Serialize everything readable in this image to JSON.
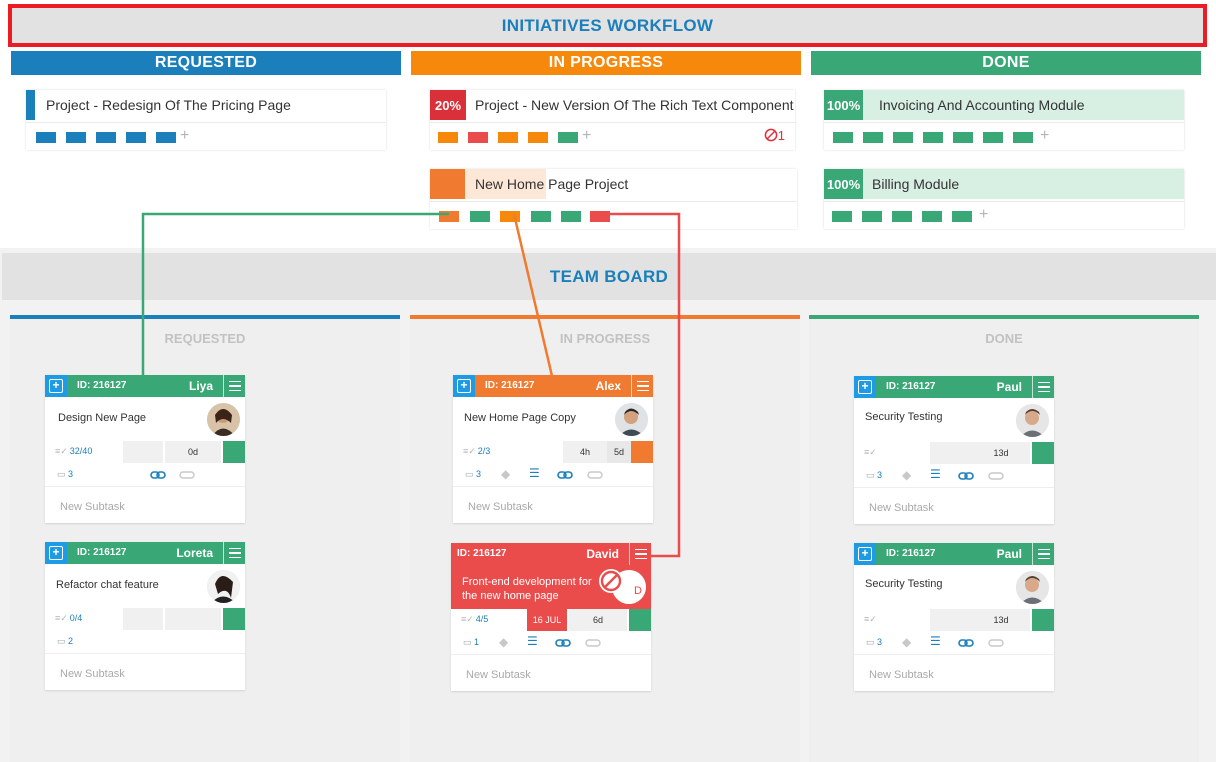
{
  "initiatives": {
    "title": "INITIATIVES WORKFLOW",
    "columns": {
      "requested": "REQUESTED",
      "in_progress": "IN PROGRESS",
      "done": "DONE"
    },
    "cards": [
      {
        "title": "Project - Redesign Of The Pricing Page",
        "progress": "",
        "accent": "#1a7fbb"
      },
      {
        "title": "Project - New Version Of The Rich Text Component",
        "progress": "20%",
        "accent": "#d9303a",
        "blockers": "1"
      },
      {
        "title": "New Home Page Project",
        "progress": "",
        "accent": "#f07a2f"
      },
      {
        "title": "Invoicing And Accounting Module",
        "progress": "100%",
        "accent": "#3aa876"
      },
      {
        "title": "Billing Module",
        "progress": "100%",
        "accent": "#3aa876"
      }
    ],
    "add_symbol": "+"
  },
  "team_board": {
    "title": "TEAM BOARD",
    "columns": {
      "requested": "REQUESTED",
      "in_progress": "IN PROGRESS",
      "done": "DONE"
    },
    "cards": [
      {
        "id": "ID: 216127",
        "owner": "Liya",
        "title": "Design New Page",
        "checklist": "32/40",
        "time": "0d",
        "comments": "3",
        "subtask": "New Subtask"
      },
      {
        "id": "ID: 216127",
        "owner": "Loreta",
        "title": "Refactor chat feature",
        "checklist": "0/4",
        "comments": "2",
        "subtask": "New Subtask"
      },
      {
        "id": "ID: 216127",
        "owner": "Alex",
        "title": "New Home Page Copy",
        "checklist": "2/3",
        "time_logged": "4h",
        "time": "5d",
        "comments": "3",
        "subtask": "New Subtask"
      },
      {
        "id": "ID: 216127",
        "owner": "David",
        "title_line1": "Front-end development for",
        "title_line2": "the new home page",
        "checklist": "4/5",
        "due": "16 JUL",
        "time": "6d",
        "comments": "1",
        "blocker_badge": "D",
        "subtask": "New Subtask"
      },
      {
        "id": "ID: 216127",
        "owner": "Paul",
        "title": "Security Testing",
        "time": "13d",
        "comments": "3",
        "subtask": "New Subtask"
      },
      {
        "id": "ID: 216127",
        "owner": "Paul",
        "title": "Security Testing",
        "time": "13d",
        "comments": "3",
        "subtask": "New Subtask"
      }
    ]
  },
  "colors": {
    "blue": "#1a7fbb",
    "orange": "#f6890c",
    "green": "#3aa876",
    "red": "#ea4b4b",
    "highlight_red": "#ec1c24"
  }
}
